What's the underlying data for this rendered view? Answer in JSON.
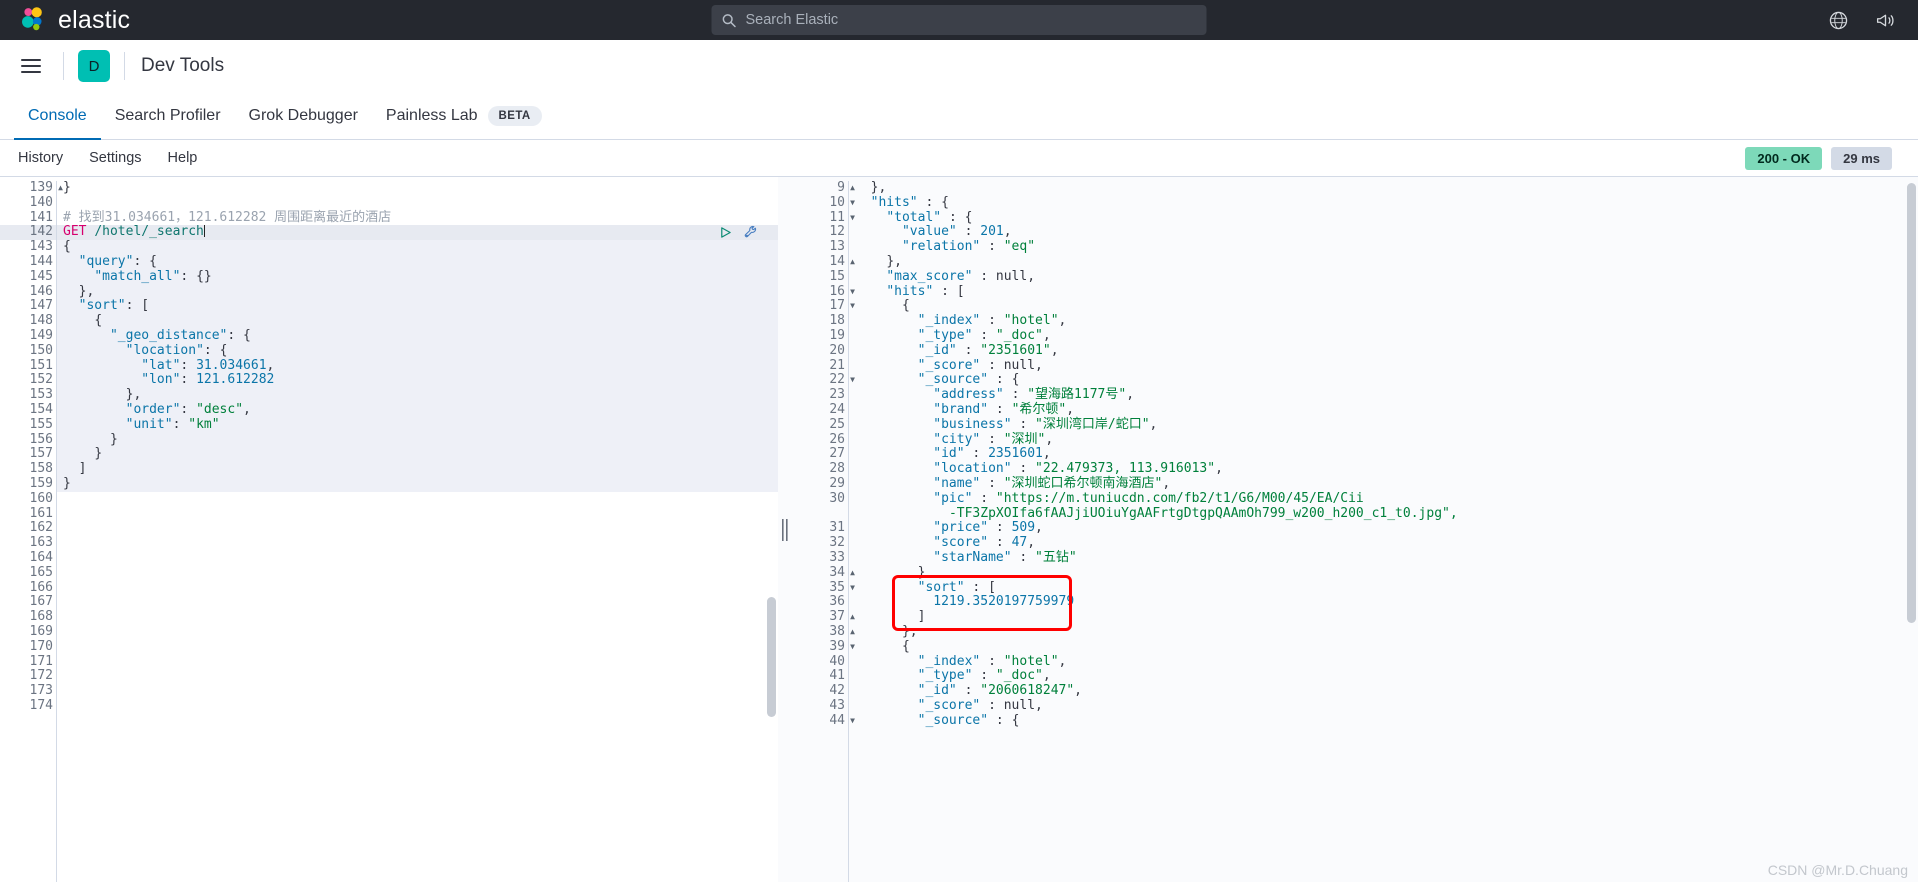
{
  "topbar": {
    "brand": "elastic",
    "search_placeholder": "Search Elastic",
    "search_icon": "search-icon",
    "help_icon": "help-circle-icon",
    "news_icon": "announcement-icon"
  },
  "appheader": {
    "menu_icon": "hamburger-menu-icon",
    "space_initial": "D",
    "title": "Dev Tools"
  },
  "tabs": [
    {
      "label": "Console",
      "active": true,
      "badge": null
    },
    {
      "label": "Search Profiler",
      "active": false,
      "badge": null
    },
    {
      "label": "Grok Debugger",
      "active": false,
      "badge": null
    },
    {
      "label": "Painless Lab",
      "active": false,
      "badge": "BETA"
    }
  ],
  "submenu": {
    "items": [
      "History",
      "Settings",
      "Help"
    ],
    "status_code": "200 - OK",
    "duration": "29 ms"
  },
  "editor": {
    "first_line_number": 139,
    "highlighted_line": 142,
    "play_icon": "play-triangle-icon",
    "wrench_icon": "wrench-icon",
    "lines": [
      {
        "n": 139,
        "fold": "up",
        "body": "}"
      },
      {
        "n": 140,
        "fold": null,
        "body": ""
      },
      {
        "n": 141,
        "fold": null,
        "body": "# 找到31.034661，121.612282 周围距离最近的酒店"
      },
      {
        "n": 142,
        "fold": null,
        "body": "GET /hotel/_search"
      },
      {
        "n": 143,
        "fold": "down",
        "body": "{"
      },
      {
        "n": 144,
        "fold": "down",
        "body": "  \"query\": {"
      },
      {
        "n": 145,
        "fold": null,
        "body": "    \"match_all\": {}"
      },
      {
        "n": 146,
        "fold": "up",
        "body": "  },"
      },
      {
        "n": 147,
        "fold": "down",
        "body": "  \"sort\": ["
      },
      {
        "n": 148,
        "fold": "down",
        "body": "    {"
      },
      {
        "n": 149,
        "fold": "down",
        "body": "      \"_geo_distance\": {"
      },
      {
        "n": 150,
        "fold": "down",
        "body": "        \"location\": {"
      },
      {
        "n": 151,
        "fold": null,
        "body": "          \"lat\": 31.034661,"
      },
      {
        "n": 152,
        "fold": null,
        "body": "          \"lon\": 121.612282"
      },
      {
        "n": 153,
        "fold": "up",
        "body": "        },"
      },
      {
        "n": 154,
        "fold": null,
        "body": "        \"order\": \"desc\","
      },
      {
        "n": 155,
        "fold": null,
        "body": "        \"unit\": \"km\""
      },
      {
        "n": 156,
        "fold": "up",
        "body": "      }"
      },
      {
        "n": 157,
        "fold": "up",
        "body": "    }"
      },
      {
        "n": 158,
        "fold": "up",
        "body": "  ]"
      },
      {
        "n": 159,
        "fold": "up",
        "body": "}"
      },
      {
        "n": 160,
        "fold": null,
        "body": ""
      },
      {
        "n": 161,
        "fold": null,
        "body": ""
      },
      {
        "n": 162,
        "fold": null,
        "body": ""
      },
      {
        "n": 163,
        "fold": null,
        "body": ""
      },
      {
        "n": 164,
        "fold": null,
        "body": ""
      },
      {
        "n": 165,
        "fold": null,
        "body": ""
      },
      {
        "n": 166,
        "fold": null,
        "body": ""
      },
      {
        "n": 167,
        "fold": null,
        "body": ""
      },
      {
        "n": 168,
        "fold": null,
        "body": ""
      },
      {
        "n": 169,
        "fold": null,
        "body": ""
      },
      {
        "n": 170,
        "fold": null,
        "body": ""
      },
      {
        "n": 171,
        "fold": null,
        "body": ""
      },
      {
        "n": 172,
        "fold": null,
        "body": ""
      },
      {
        "n": 173,
        "fold": null,
        "body": ""
      },
      {
        "n": 174,
        "fold": null,
        "body": ""
      }
    ],
    "request_comment": "# 找到31.034661，121.612282 周围距离最近的酒店",
    "request_method": "GET",
    "request_path": "/hotel/_search"
  },
  "response": {
    "lines": [
      {
        "n": 9,
        "fold": "up",
        "body": "  },"
      },
      {
        "n": 10,
        "fold": "down",
        "body": "  \"hits\" : {"
      },
      {
        "n": 11,
        "fold": "down",
        "body": "    \"total\" : {"
      },
      {
        "n": 12,
        "fold": null,
        "body": "      \"value\" : 201,"
      },
      {
        "n": 13,
        "fold": null,
        "body": "      \"relation\" : \"eq\""
      },
      {
        "n": 14,
        "fold": "up",
        "body": "    },"
      },
      {
        "n": 15,
        "fold": null,
        "body": "    \"max_score\" : null,"
      },
      {
        "n": 16,
        "fold": "down",
        "body": "    \"hits\" : ["
      },
      {
        "n": 17,
        "fold": "down",
        "body": "      {"
      },
      {
        "n": 18,
        "fold": null,
        "body": "        \"_index\" : \"hotel\","
      },
      {
        "n": 19,
        "fold": null,
        "body": "        \"_type\" : \"_doc\","
      },
      {
        "n": 20,
        "fold": null,
        "body": "        \"_id\" : \"2351601\","
      },
      {
        "n": 21,
        "fold": null,
        "body": "        \"_score\" : null,"
      },
      {
        "n": 22,
        "fold": "down",
        "body": "        \"_source\" : {"
      },
      {
        "n": 23,
        "fold": null,
        "body": "          \"address\" : \"望海路1177号\","
      },
      {
        "n": 24,
        "fold": null,
        "body": "          \"brand\" : \"希尔顿\","
      },
      {
        "n": 25,
        "fold": null,
        "body": "          \"business\" : \"深圳湾口岸/蛇口\","
      },
      {
        "n": 26,
        "fold": null,
        "body": "          \"city\" : \"深圳\","
      },
      {
        "n": 27,
        "fold": null,
        "body": "          \"id\" : 2351601,"
      },
      {
        "n": 28,
        "fold": null,
        "body": "          \"location\" : \"22.479373, 113.916013\","
      },
      {
        "n": 29,
        "fold": null,
        "body": "          \"name\" : \"深圳蛇口希尔顿南海酒店\","
      },
      {
        "n": 30,
        "fold": null,
        "body": "          \"pic\" : \"https://m.tuniucdn.com/fb2/t1/G6/M00/45/EA/Cii"
      },
      {
        "n": null,
        "fold": null,
        "body": "            -TF3ZpXOIfa6fAAJjiUOiuYgAAFrtgDtgpQAAmOh799_w200_h200_c1_t0.jpg\","
      },
      {
        "n": 31,
        "fold": null,
        "body": "          \"price\" : 509,"
      },
      {
        "n": 32,
        "fold": null,
        "body": "          \"score\" : 47,"
      },
      {
        "n": 33,
        "fold": null,
        "body": "          \"starName\" : \"五钻\""
      },
      {
        "n": 34,
        "fold": "up",
        "body": "        }"
      },
      {
        "n": 35,
        "fold": "down",
        "body": "        \"sort\" : ["
      },
      {
        "n": 36,
        "fold": null,
        "body": "          1219.3520197759979"
      },
      {
        "n": 37,
        "fold": "up",
        "body": "        ]"
      },
      {
        "n": 38,
        "fold": "up",
        "body": "      },"
      },
      {
        "n": 39,
        "fold": "down",
        "body": "      {"
      },
      {
        "n": 40,
        "fold": null,
        "body": "        \"_index\" : \"hotel\","
      },
      {
        "n": 41,
        "fold": null,
        "body": "        \"_type\" : \"_doc\","
      },
      {
        "n": 42,
        "fold": null,
        "body": "        \"_id\" : \"2060618247\","
      },
      {
        "n": 43,
        "fold": null,
        "body": "        \"_score\" : null,"
      },
      {
        "n": 44,
        "fold": "down",
        "body": "        \"_source\" : {"
      }
    ],
    "highlight_annotation": {
      "color": "#ff0000",
      "covers_lines": [
        35,
        36,
        37
      ],
      "content": "\"sort\" : [ 1219.3520197759979 ]"
    },
    "total_value": 201,
    "total_relation": "eq",
    "max_score": "null",
    "first_hit": {
      "_index": "hotel",
      "_type": "_doc",
      "_id": "2351601",
      "_score": "null",
      "address": "望海路1177号",
      "brand": "希尔顿",
      "business": "深圳湾口岸/蛇口",
      "city": "深圳",
      "id": 2351601,
      "location": "22.479373, 113.916013",
      "name": "深圳蛇口希尔顿南海酒店",
      "pic": "https://m.tuniucdn.com/fb2/t1/G6/M00/45/EA/Cii-TF3ZpXOIfa6fAAJjiUOiuYgAAFrtgDtgpQAAmOh799_w200_h200_c1_t0.jpg",
      "price": 509,
      "score": 47,
      "starName": "五钻",
      "sort": 1219.3520197759979
    },
    "second_hit": {
      "_index": "hotel",
      "_type": "_doc",
      "_id": "2060618247",
      "_score": "null"
    }
  },
  "watermark": "CSDN @Mr.D.Chuang",
  "colors": {
    "brand_dark": "#25282f",
    "accent_blue": "#006bb4",
    "teal": "#00bfb3",
    "ok_green": "#7dd9b9",
    "annotation_red": "#ff0000"
  }
}
